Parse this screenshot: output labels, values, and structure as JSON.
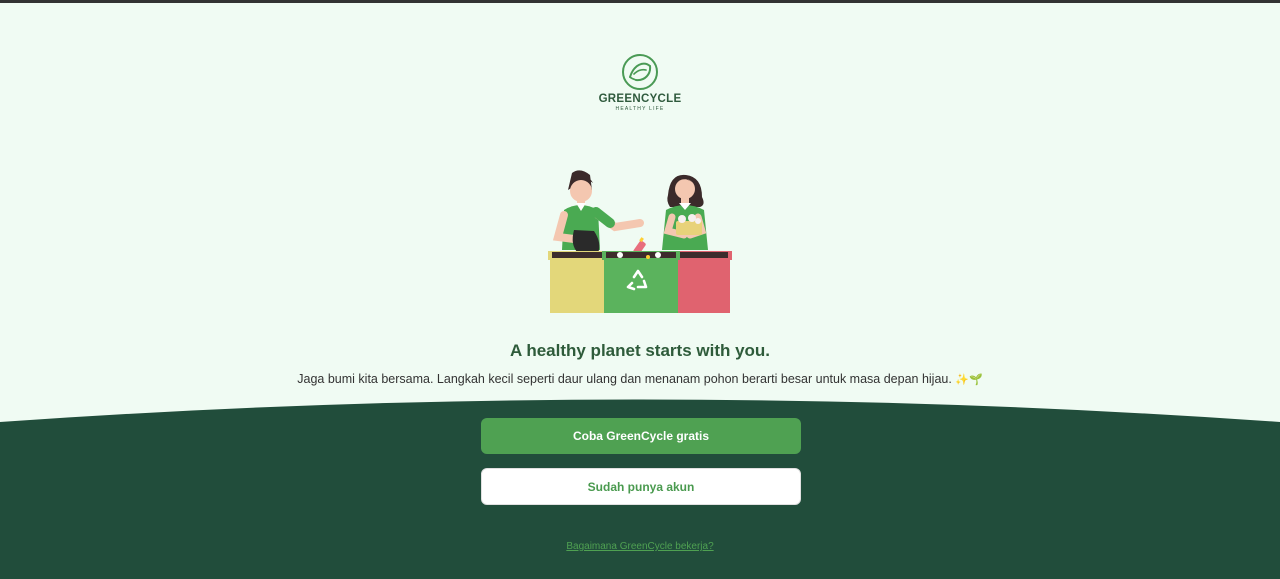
{
  "brand": {
    "name": "GREENCYCLE",
    "tagline": "HEALTHY LIFE",
    "logo_icon": "leaf-cycle-icon"
  },
  "hero": {
    "illustration": "recycling-people-illustration",
    "headline": "A healthy planet starts with you.",
    "subtext": "Jaga bumi kita bersama. Langkah kecil seperti daur ulang dan menanam pohon berarti besar untuk masa depan hijau.",
    "subtext_emojis": "✨🌱"
  },
  "actions": {
    "primary_label": "Coba GreenCycle gratis",
    "secondary_label": "Sudah punya akun",
    "how_link": "Bagaimana GreenCycle bekerja?"
  },
  "colors": {
    "page_bg": "#f0fbf3",
    "panel_bg": "#214d3b",
    "primary": "#4fa152",
    "headline": "#2e5b3a"
  }
}
